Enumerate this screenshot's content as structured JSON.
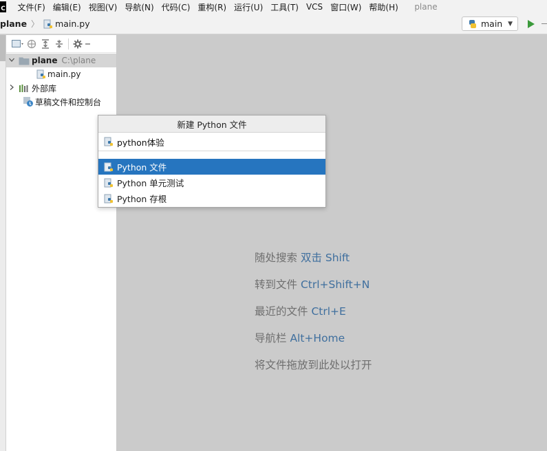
{
  "app_logo": "C",
  "menu": [
    "文件(F)",
    "编辑(E)",
    "视图(V)",
    "导航(N)",
    "代码(C)",
    "重构(R)",
    "运行(U)",
    "工具(T)",
    "VCS",
    "窗口(W)",
    "帮助(H)"
  ],
  "project_title": "plane",
  "breadcrumb": {
    "root": "plane",
    "file": "main.py"
  },
  "run_config": {
    "label": "main"
  },
  "project_panel": {
    "tree": {
      "root_name": "plane",
      "root_path": "C:\\plane",
      "file": "main.py",
      "external_libs": "外部库",
      "scratches": "草稿文件和控制台"
    }
  },
  "popup": {
    "title": "新建 Python 文件",
    "input_value": "python体验",
    "items": [
      "Python 文件",
      "Python 单元测试",
      "Python 存根"
    ],
    "selected_index": 0
  },
  "hints": [
    {
      "text": "随处搜索 ",
      "key": "双击 Shift"
    },
    {
      "text": "转到文件 ",
      "key": "Ctrl+Shift+N"
    },
    {
      "text": "最近的文件 ",
      "key": "Ctrl+E"
    },
    {
      "text": "导航栏 ",
      "key": "Alt+Home"
    },
    {
      "text": "将文件拖放到此处以打开",
      "key": ""
    }
  ],
  "colors": {
    "selection": "#2675bf",
    "hint_key": "#3f6f9e",
    "editor_bg": "#cbcbcb"
  },
  "icons": [
    "python-file-icon",
    "folder-icon",
    "library-icon",
    "scratch-icon",
    "gear-icon",
    "collapse-icon",
    "expand-icon",
    "locate-icon",
    "run-icon"
  ]
}
